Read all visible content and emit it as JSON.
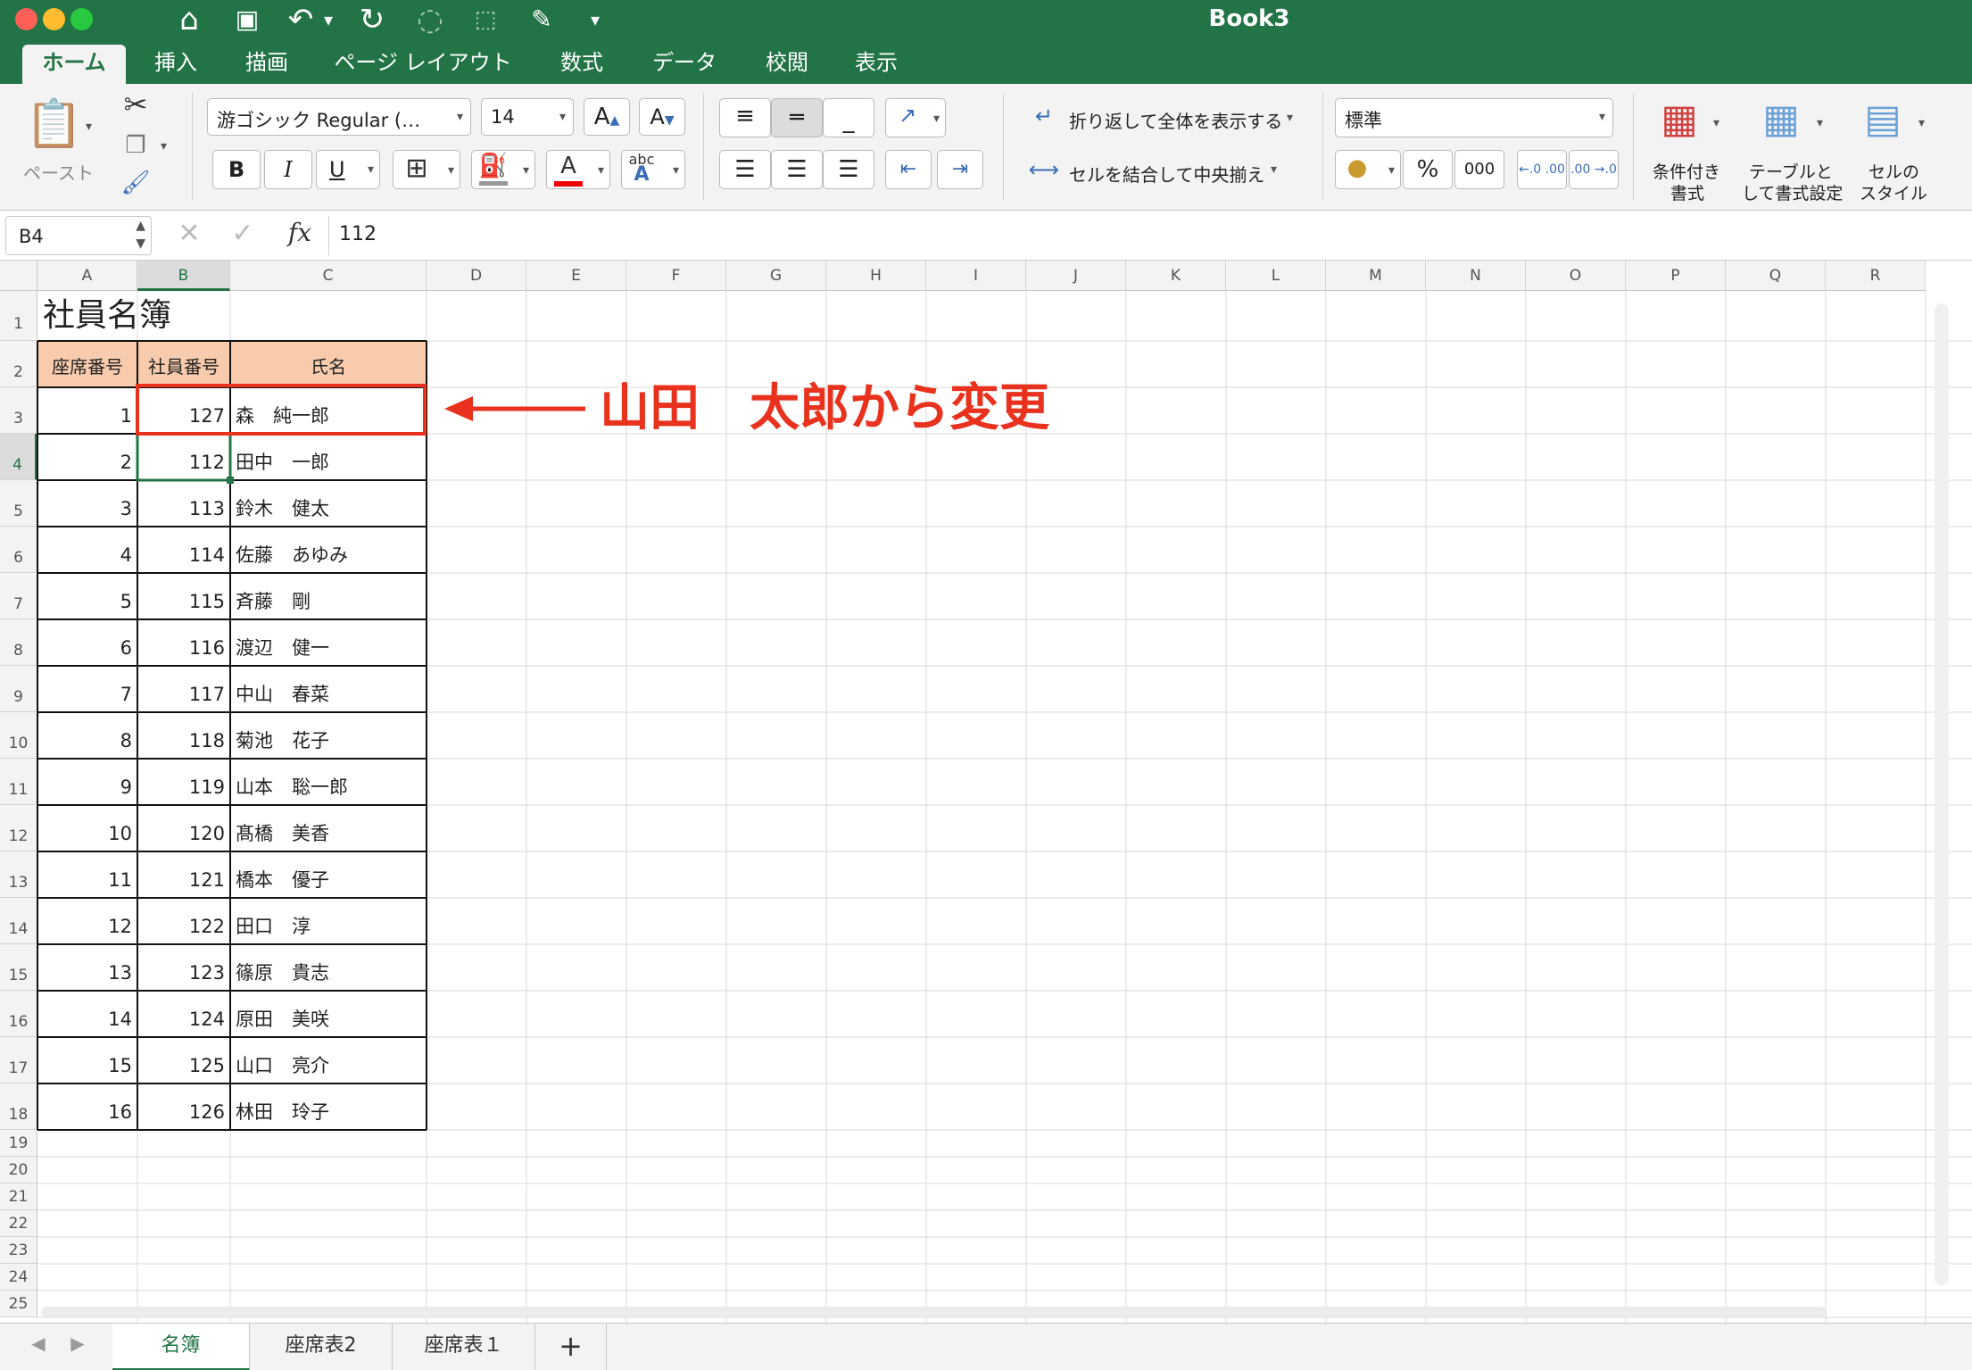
{
  "titlebar": {
    "title": "Book3",
    "icons": [
      "home-icon",
      "save-icon",
      "undo-icon",
      "redo-icon",
      "lasso-icon",
      "select-icon",
      "pen-icon",
      "customize-icon"
    ]
  },
  "tabs": [
    {
      "label": "ホーム",
      "active": true
    },
    {
      "label": "挿入"
    },
    {
      "label": "描画"
    },
    {
      "label": "ページ レイアウト"
    },
    {
      "label": "数式"
    },
    {
      "label": "データ"
    },
    {
      "label": "校閲"
    },
    {
      "label": "表示"
    }
  ],
  "ribbon": {
    "paste_label": "ペースト",
    "font_name": "游ゴシック Regular (…",
    "font_size": "14",
    "font_grow": "A",
    "font_shrink": "A",
    "bold": "B",
    "italic": "I",
    "underline": "U",
    "font_color_label": "A",
    "abc_label": "abc",
    "wrap_text": "折り返して全体を表示する",
    "merge_center": "セルを結合して中央揃え",
    "number_format": "標準",
    "percent": "%",
    "comma": "000",
    "dec_inc": "←.0 .00",
    "dec_dec": ".00 →.0",
    "cond_format": [
      "条件付き",
      "書式"
    ],
    "table_format": [
      "テーブルと",
      "して書式設定"
    ],
    "cell_styles": [
      "セルの",
      "スタイル"
    ]
  },
  "formula_bar": {
    "name_box": "B4",
    "fx": "fx",
    "value": "112"
  },
  "columns": [
    "A",
    "B",
    "C",
    "D",
    "E",
    "F",
    "G",
    "H",
    "I",
    "J",
    "K",
    "L",
    "M",
    "N",
    "O",
    "P",
    "Q",
    "R"
  ],
  "selected_column": "B",
  "selected_row": "4",
  "sheet": {
    "title": "社員名簿",
    "headers": [
      "座席番号",
      "社員番号",
      "氏名"
    ],
    "rows": [
      [
        "1",
        "127",
        "森　純一郎"
      ],
      [
        "2",
        "112",
        "田中　一郎"
      ],
      [
        "3",
        "113",
        "鈴木　健太"
      ],
      [
        "4",
        "114",
        "佐藤　あゆみ"
      ],
      [
        "5",
        "115",
        "斉藤　剛"
      ],
      [
        "6",
        "116",
        "渡辺　健一"
      ],
      [
        "7",
        "117",
        "中山　春菜"
      ],
      [
        "8",
        "118",
        "菊池　花子"
      ],
      [
        "9",
        "119",
        "山本　聡一郎"
      ],
      [
        "10",
        "120",
        "髙橋　美香"
      ],
      [
        "11",
        "121",
        "橋本　優子"
      ],
      [
        "12",
        "122",
        "田口　淳"
      ],
      [
        "13",
        "123",
        "篠原　貴志"
      ],
      [
        "14",
        "124",
        "原田　美咲"
      ],
      [
        "15",
        "125",
        "山口　亮介"
      ],
      [
        "16",
        "126",
        "林田　玲子"
      ]
    ]
  },
  "annotation": {
    "text": "山田　太郎から変更",
    "color": "#e8321e"
  },
  "sheet_tabs": [
    {
      "label": "名簿",
      "active": true
    },
    {
      "label": "座席表2"
    },
    {
      "label": "座席表１"
    }
  ],
  "add_sheet": "+",
  "colors": {
    "accent": "#227446",
    "header_fill": "#f8cbad",
    "annotation": "#e8321e"
  }
}
